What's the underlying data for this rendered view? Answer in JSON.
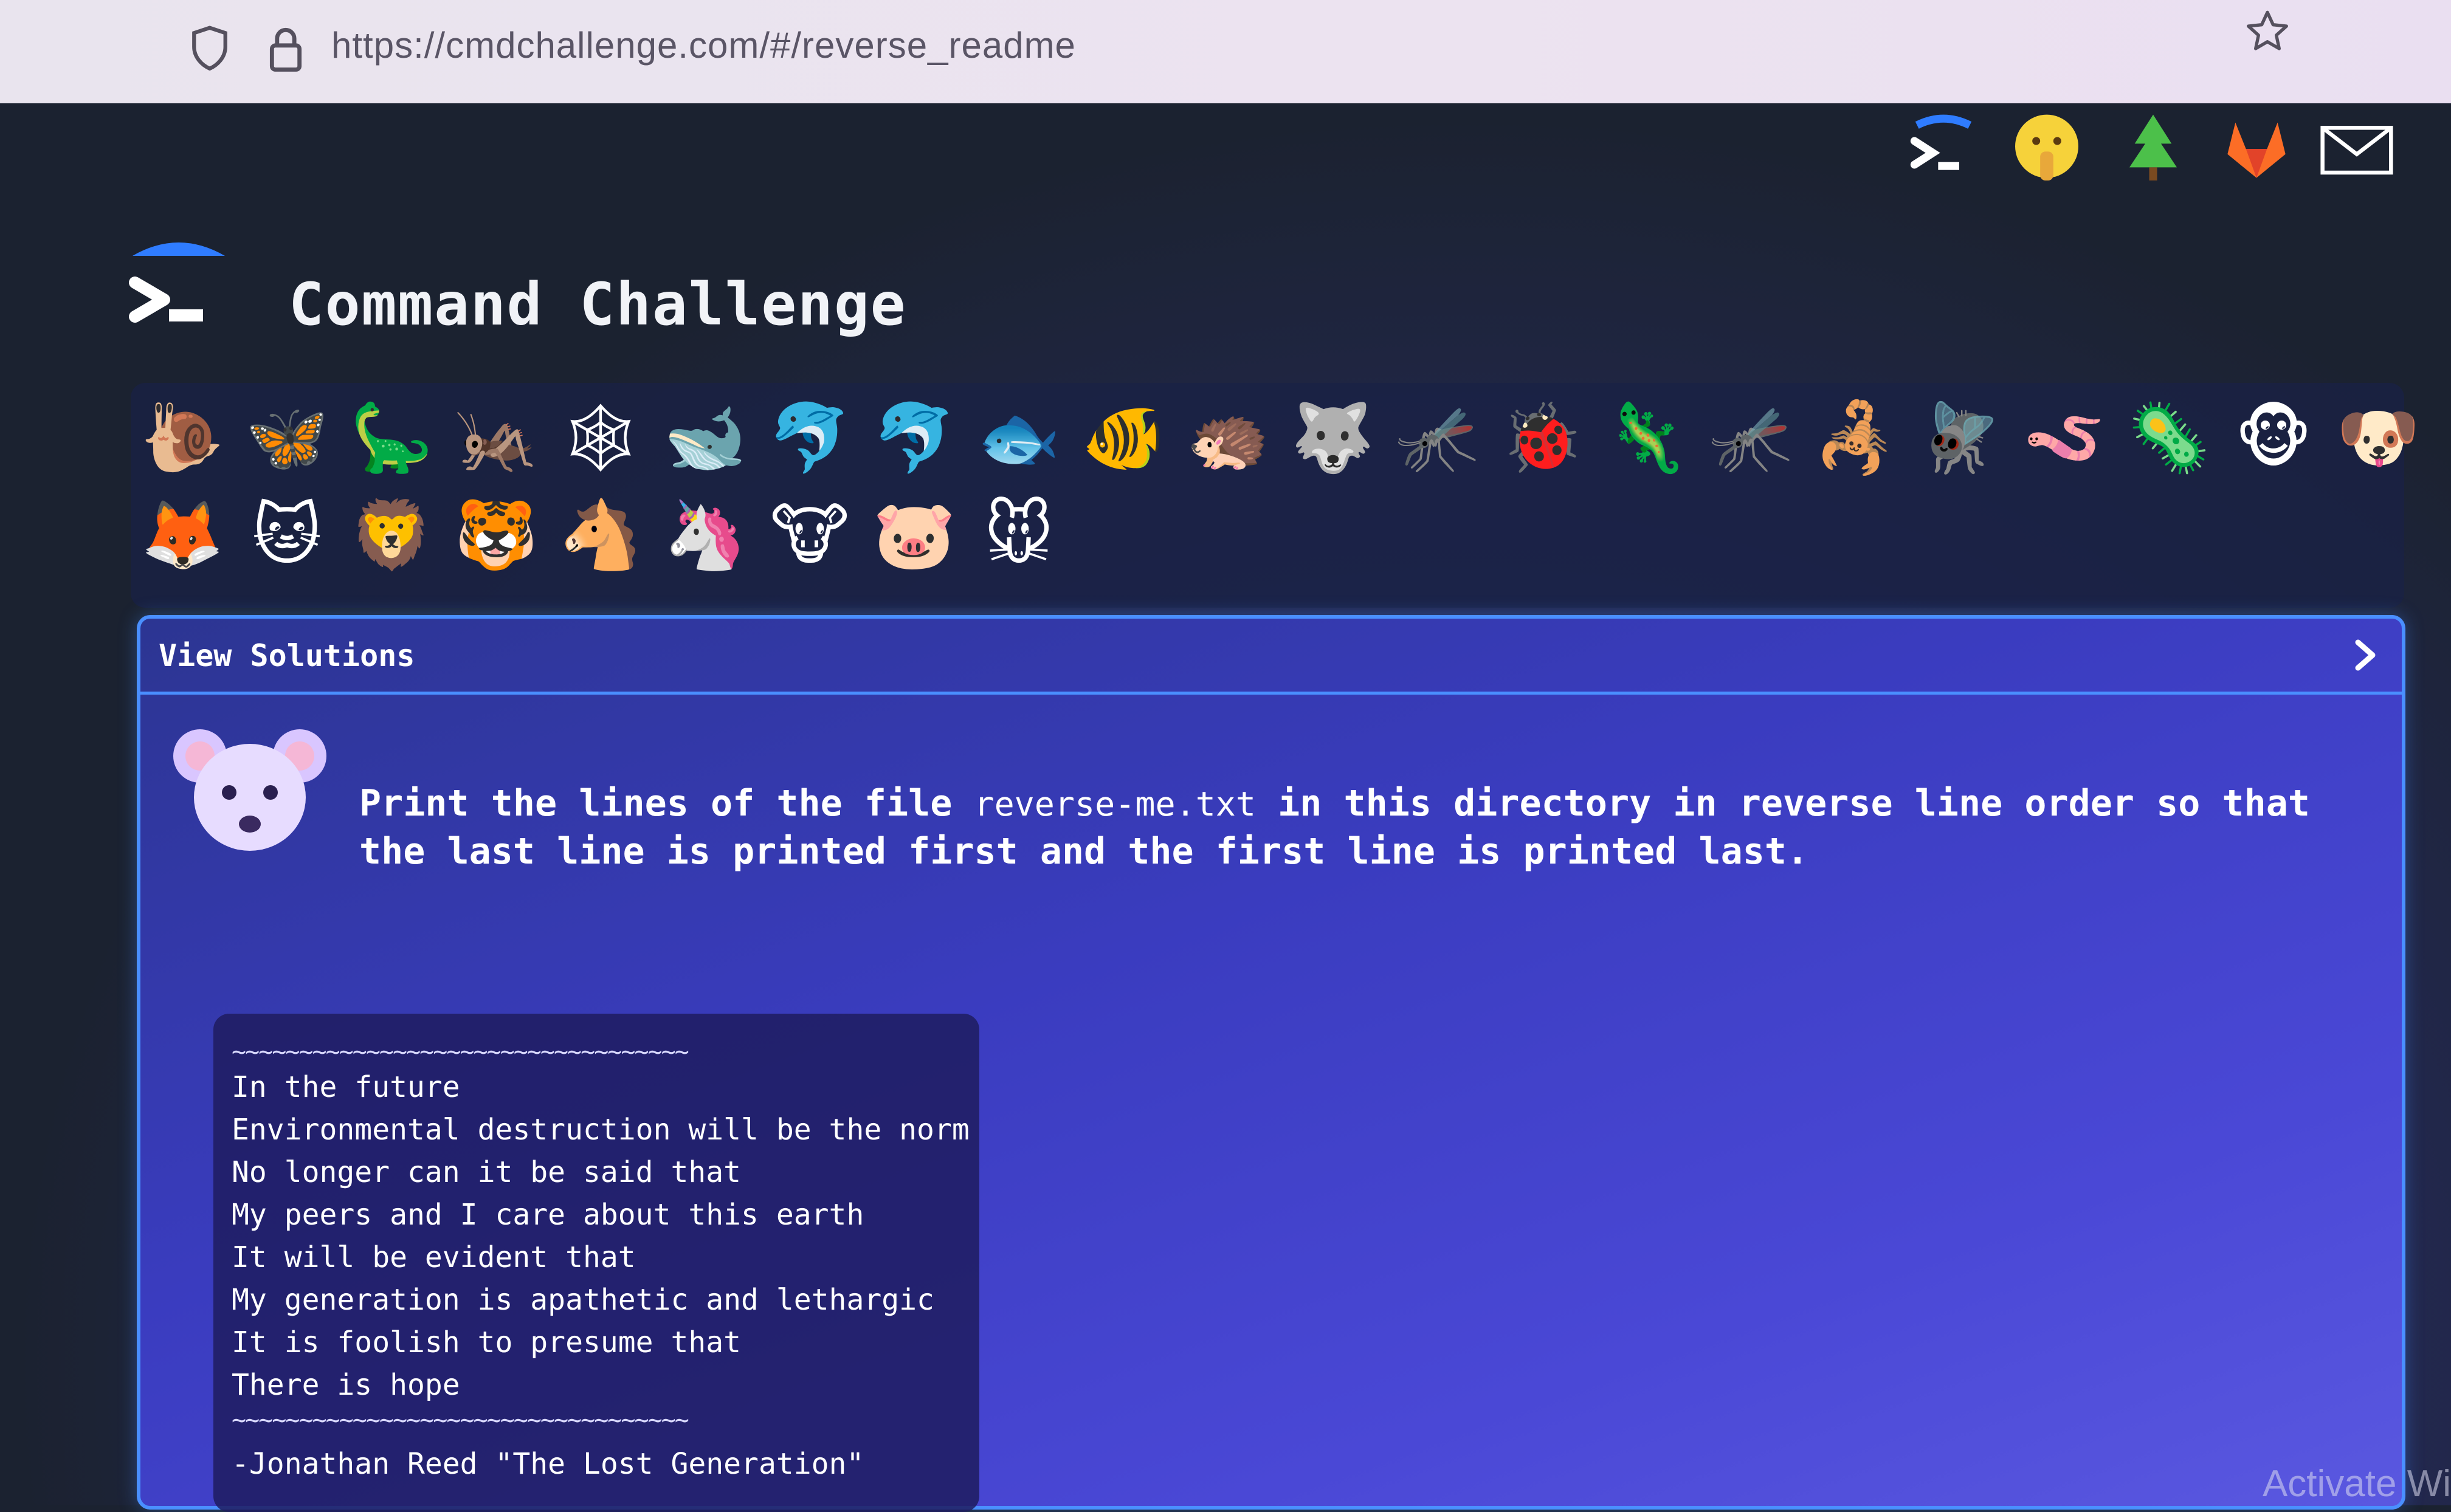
{
  "browser": {
    "url": "https://cmdchallenge.com/#/reverse_readme",
    "icons": [
      "shield-icon",
      "lock-icon",
      "star-icon"
    ]
  },
  "header": {
    "title": "Command Challenge",
    "top_icons": [
      "terminal-icon",
      "shushing-face-icon",
      "tree-icon",
      "gitlab-fox-icon",
      "mail-icon"
    ]
  },
  "animals": {
    "row1": [
      "🐌",
      "🦋",
      "🦕",
      "🦗",
      "🕸",
      "🐋",
      "🐬",
      "🐬",
      "🐟",
      "🐠",
      "🦔",
      "🐺",
      "🦟",
      "🐞",
      "🦎",
      "🦟",
      "🦂",
      "🪰",
      "🪱",
      "🦠",
      "🐵",
      "🐶"
    ],
    "row2": [
      "🦊",
      "🐱",
      "🦁",
      "🐯",
      "🐴",
      "🦄",
      "🐮",
      "🐷",
      "🐭"
    ]
  },
  "panel": {
    "header_label": "View Solutions",
    "prompt_before": "Print the lines of the file ",
    "prompt_file": "reverse-me.txt",
    "prompt_after": " in this directory in reverse line order so that the last line is printed first and the first line is printed last."
  },
  "poem": {
    "separator": "~~~~~~~~~~~~~~~~~~~~~~~~~~~~~~~~~~",
    "lines": [
      "In the future",
      "Environmental destruction will be the norm",
      "No longer can it be said that",
      "My peers and I care about this earth",
      "It will be evident that",
      "My generation is apathetic and lethargic",
      "It is foolish to presume that",
      "There is hope"
    ],
    "author": "-Jonathan Reed \"The Lost Generation\""
  },
  "watermark": "Activate Wi",
  "colors": {
    "accent": "#4a8fff",
    "panel": "#3a3cbf",
    "background": "#1b2230"
  }
}
